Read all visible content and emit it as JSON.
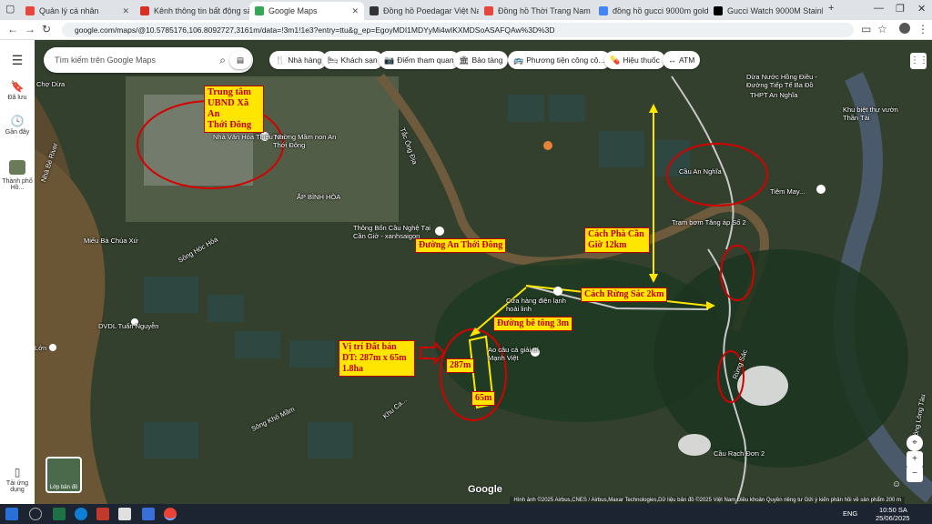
{
  "tabs": [
    {
      "title": "Quản lý cá nhân",
      "color": "#e8453c"
    },
    {
      "title": "Kênh thông tin bất động sản -",
      "color": "#d93025"
    },
    {
      "title": "Google Maps",
      "color": "#34a853"
    },
    {
      "title": "Đồng hồ Poedagar Việt Nam",
      "color": "#333333"
    },
    {
      "title": "Đồng hồ Thời Trang Nam Poed",
      "color": "#e8453c"
    },
    {
      "title": "đồng hồ gucci 9000m gold - Tì",
      "color": "#4285f4"
    },
    {
      "title": "Gucci Watch 9000M Stainless S",
      "color": "#000000"
    }
  ],
  "address": {
    "url": "google.com/maps/@10.5785176,106.8092727,3161m/data=!3m1!1e3?entry=ttu&g_ep=EgoyMDI1MDYyMi4wIKXMDSoASAFQAw%3D%3D"
  },
  "sidebar": {
    "menu_icon": "menu-icon",
    "items": [
      {
        "label": "Đã lưu",
        "icon": "bookmark-icon"
      },
      {
        "label": "Gần đây",
        "icon": "history-icon"
      },
      {
        "label": "Thành phố Hồ...",
        "icon": "city-thumbnail"
      },
      {
        "label": "Tải ứng dụng",
        "icon": "phone-icon"
      }
    ]
  },
  "search": {
    "placeholder": "Tìm kiếm trên Google Maps"
  },
  "chips": [
    {
      "label": "Nhà hàng",
      "icon": "🍴"
    },
    {
      "label": "Khách sạn",
      "icon": "🛏"
    },
    {
      "label": "Điểm tham quan",
      "icon": "📷"
    },
    {
      "label": "Bảo tàng",
      "icon": "🏛"
    },
    {
      "label": "Phương tiện công cộ...",
      "icon": "🚌"
    },
    {
      "label": "Hiệu thuốc",
      "icon": "💊"
    },
    {
      "label": "ATM",
      "icon": "↔"
    }
  ],
  "map_labels": {
    "cho_dua": "Chợ Dừa",
    "truong": "Trường Mầm non An Thới Đông",
    "nha_van_hoa": "Nhà Văn Hóa Thiếu Nhi",
    "ap_binh_hoa": "ẤP BÌNH HÒA",
    "thong_bon": "Thông Bốn Cầu Nghệ Tại Cần Giờ - xanhsaigon",
    "mieu": "Miếu Bà Chúa Xứ",
    "song_hoc_hoa": "Sông Hóc Hỏa",
    "nha_be_river": "Nhà Bè River",
    "dvdl": "DVDL Tuấn Nguyễn",
    "lon": "Lớn",
    "cua_hang": "Cửa hàng điện lạnh hoài linh",
    "ao_cau": "Ao câu cá giải trí Mạnh Việt",
    "song_kho_mam": "Sông Khô Mầm",
    "khu_ca": "Khu Ca...",
    "cau_an_nghia": "Cầu An Nghĩa",
    "tiem_may": "Tiệm May...",
    "tram_bom": "Trạm bơm Tăng áp Số 2",
    "thpt": "THPT An Nghĩa",
    "dua_nuoc": "Dừa Nước Hồng Điều - Đường Tiếp Tế Ba Đồ",
    "khu_biet_thu": "Khu biệt thự vườn Thần Tài",
    "rung_sac_road": "Rừng Sác",
    "cau_rach_don": "Cầu Rạch Đơn 2",
    "song_long_tau": "Sông Lòng Tàu",
    "tac_ong_dia": "Tắc Ông Địa"
  },
  "annotations": {
    "trung_tam": "Trung tâm\nUBND Xã An\nThới Đông",
    "duong_an_thoi_dong": "Đường An Thới Đông",
    "cach_pha": "Cách Phà Cần\nGiờ 12km",
    "cach_rung_sac": "Cách Rừng Sác 2km",
    "duong_be_tong": "Đường bê tông 3m",
    "vi_tri": "Vị trí Đất bán\nDT: 287m x 65m\n1.8ha",
    "len_287": "287m",
    "len_65": "65m"
  },
  "google_logo": "Google",
  "layers_label": "Lớp bản đồ",
  "attribution": "Hình ảnh ©2025 Airbus,CNES / Airbus,Maxar Technologies,Dữ liệu bản đồ ©2025   Việt Nam   Điều khoản   Quyền riêng tư   Gửi ý kiến phản hồi về sản phẩm   200 m",
  "taskbar": {
    "time": "10:50 SA",
    "date": "25/06/2025",
    "lang": "ENG"
  },
  "colors": {
    "annotation_red": "#d40000",
    "annotation_yellow": "#ffe600"
  }
}
